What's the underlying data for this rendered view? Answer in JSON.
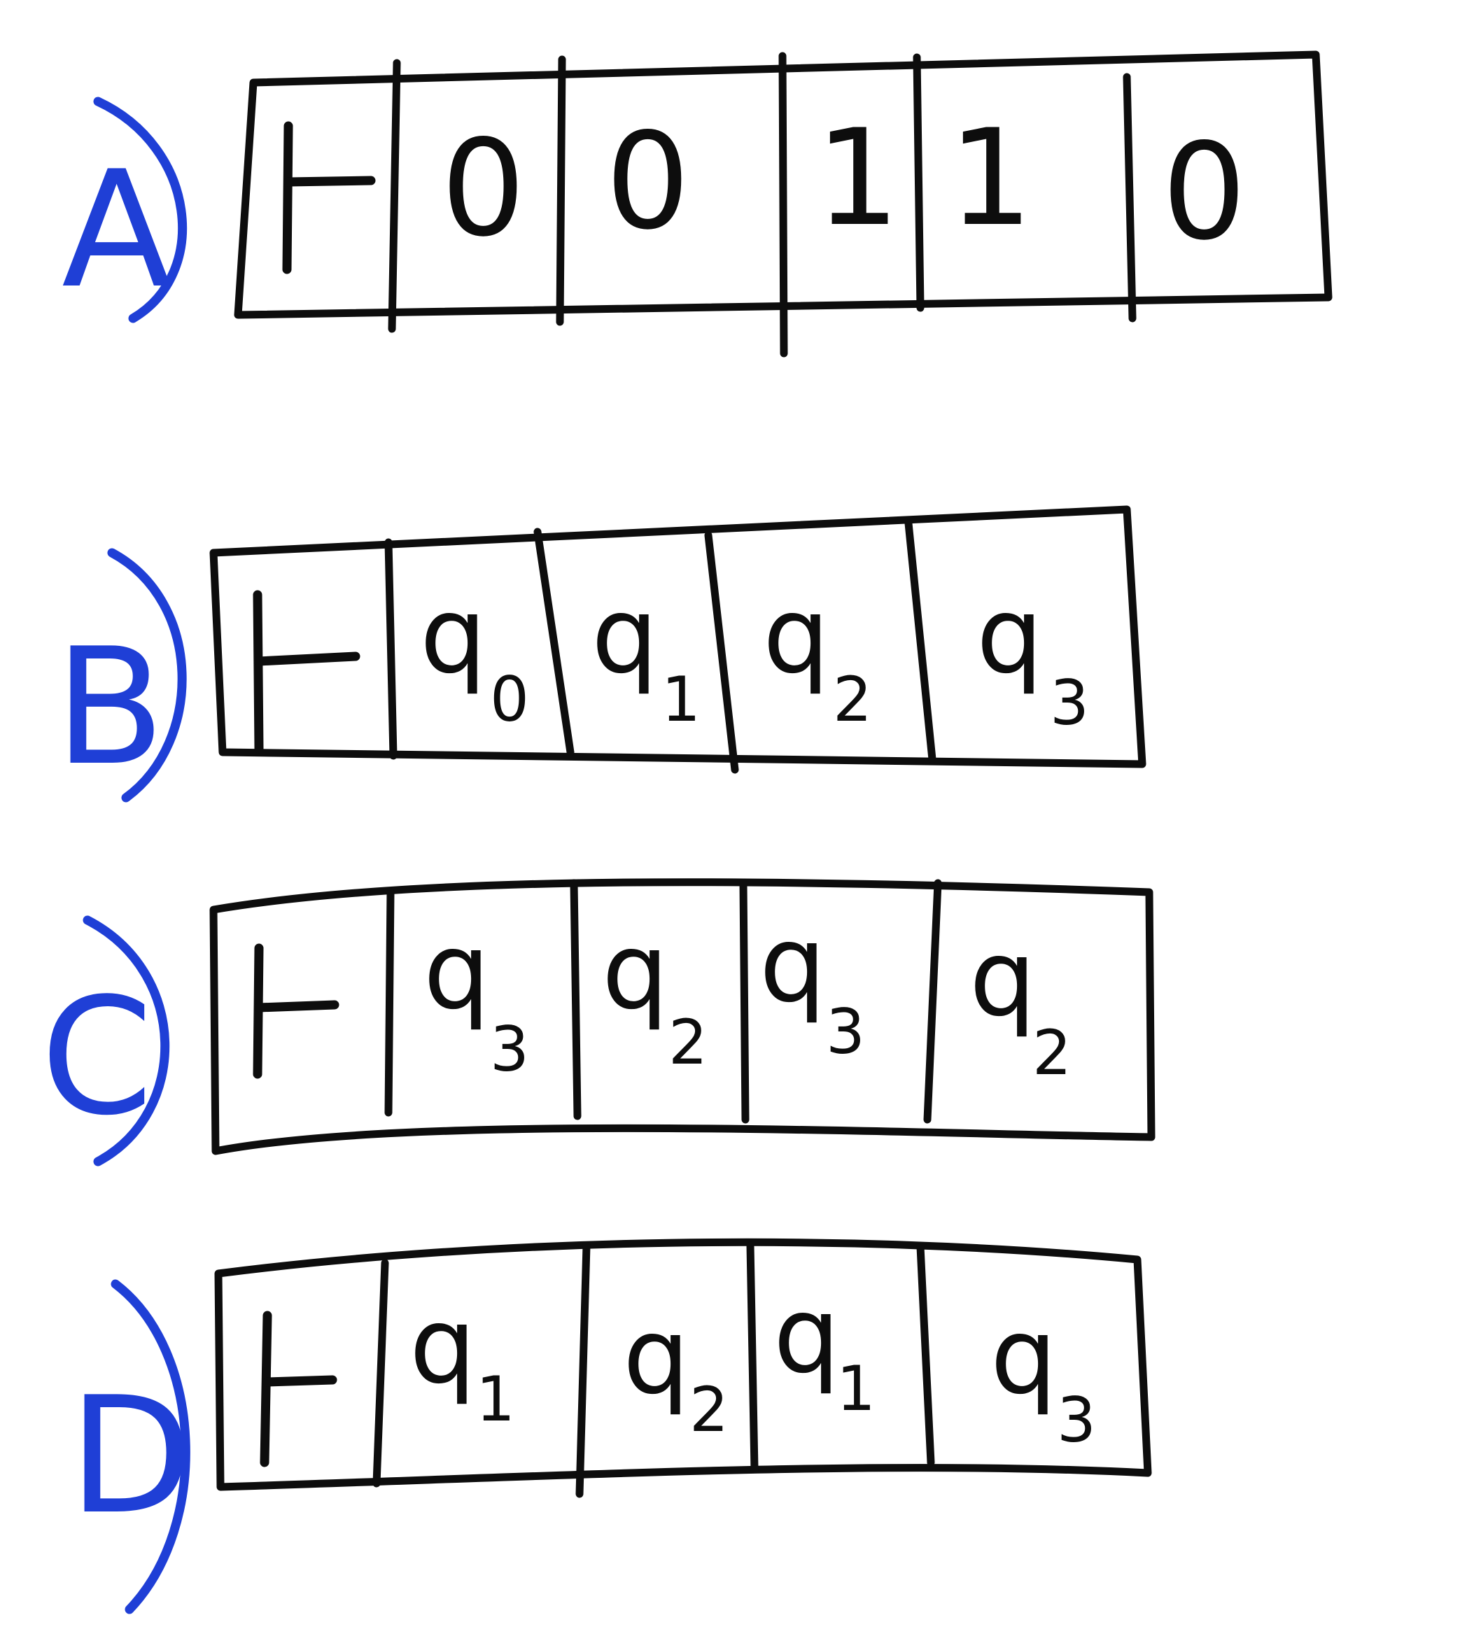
{
  "tapes": [
    {
      "label": "A",
      "cells": [
        {
          "symbol": "⊢",
          "base": "",
          "sub": ""
        },
        {
          "symbol": "0",
          "base": "",
          "sub": ""
        },
        {
          "symbol": "0",
          "base": "",
          "sub": ""
        },
        {
          "symbol": "1",
          "base": "",
          "sub": ""
        },
        {
          "symbol": "1",
          "base": "",
          "sub": ""
        },
        {
          "symbol": "0",
          "base": "",
          "sub": ""
        }
      ]
    },
    {
      "label": "B",
      "cells": [
        {
          "symbol": "⊢",
          "base": "",
          "sub": ""
        },
        {
          "symbol": "",
          "base": "q",
          "sub": "0"
        },
        {
          "symbol": "",
          "base": "q",
          "sub": "1"
        },
        {
          "symbol": "",
          "base": "q",
          "sub": "2"
        },
        {
          "symbol": "",
          "base": "q",
          "sub": "3"
        }
      ]
    },
    {
      "label": "C",
      "cells": [
        {
          "symbol": "⊢",
          "base": "",
          "sub": ""
        },
        {
          "symbol": "",
          "base": "q",
          "sub": "3"
        },
        {
          "symbol": "",
          "base": "q",
          "sub": "2"
        },
        {
          "symbol": "",
          "base": "q",
          "sub": "3"
        },
        {
          "symbol": "",
          "base": "q",
          "sub": "2"
        }
      ]
    },
    {
      "label": "D",
      "cells": [
        {
          "symbol": "⊢",
          "base": "",
          "sub": ""
        },
        {
          "symbol": "",
          "base": "q",
          "sub": "1"
        },
        {
          "symbol": "",
          "base": "q",
          "sub": "2"
        },
        {
          "symbol": "",
          "base": "q",
          "sub": "1"
        },
        {
          "symbol": "",
          "base": "q",
          "sub": "3"
        }
      ]
    }
  ],
  "colors": {
    "ink": "#0d0d0d",
    "label_ink": "#1f3fd6",
    "paper": "#ffffff"
  }
}
